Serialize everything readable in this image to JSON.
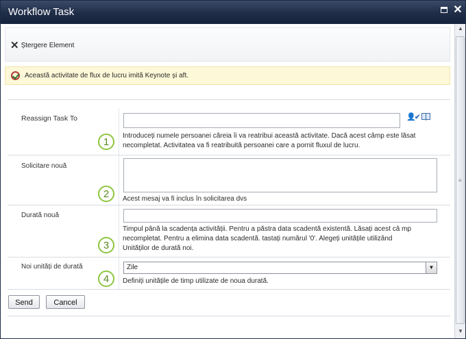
{
  "window": {
    "title": "Workflow Task"
  },
  "toolbar": {
    "delete_label": "Ștergere  Element"
  },
  "status_message": "Această activitate de flux de lucru imită Keynote și aft.",
  "form": {
    "reassign": {
      "label": "Reassign Task To",
      "value": "",
      "badge": "1",
      "description_line1": "Introduceți numele persoanei căreia îi va reatribui această activitate. Dacă acest câmp este lăsat",
      "description_line2": "necompletat. Activitatea va fi reatribuită persoanei care a pornit fluxul de lucru."
    },
    "new_request": {
      "label": "Solicitare nouă",
      "value": "",
      "badge": "2",
      "description": "Acest mesaj va fi inclus în solicitarea dvs"
    },
    "new_duration": {
      "label": "Durată nouă",
      "value": "",
      "badge": "3",
      "description_line1": "Timpul până la scadența activității. Pentru a păstra data scadentă existentă. Lăsați acest câ mp",
      "description_line2": "necompletat. Pentru a elimina data scadentă. tastați numărul        '0'. Alegeți unitățile utilizând",
      "description_line3": "Unităților de durată noi."
    },
    "duration_units": {
      "label": "Noi unități de durată",
      "selected": "Zile",
      "badge": "4",
      "description": "Definiți unitățile de timp utilizate de noua durată."
    }
  },
  "buttons": {
    "send": "Send",
    "cancel": "Cancel"
  },
  "icons": {
    "maximize": "maximize-icon",
    "close": "close-icon",
    "delete": "delete-icon",
    "status": "status-check-icon",
    "check_names": "check-names-icon",
    "address_book": "address-book-icon",
    "dropdown": "chevron-down-icon"
  },
  "colors": {
    "title_bar": "#1f2d48",
    "status_background": "#fdf8d8",
    "badge_border": "#8dc63f"
  }
}
